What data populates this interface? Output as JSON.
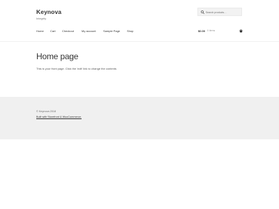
{
  "site": {
    "title": "Keynova",
    "tagline": "Integrity"
  },
  "search": {
    "placeholder": "Search products…",
    "value": ""
  },
  "nav": {
    "items": [
      "Home",
      "Cart",
      "Checkout",
      "My account",
      "Sample Page",
      "Shop"
    ]
  },
  "cart": {
    "amount": "$0.00",
    "items": "0 items"
  },
  "main": {
    "title": "Home page",
    "text": "This is your front page. Click the 'edit' link to change the contents"
  },
  "footer": {
    "copyright": "© Keynova 2018",
    "credit": "Built with Storefront & WooCommerce."
  },
  "colors": {
    "background": "#ffffff",
    "footer_background": "#f0f0f0",
    "heading": "#333333",
    "text": "#6d6d6d"
  },
  "icons": {
    "search": "search-icon",
    "cart": "cart-icon"
  }
}
